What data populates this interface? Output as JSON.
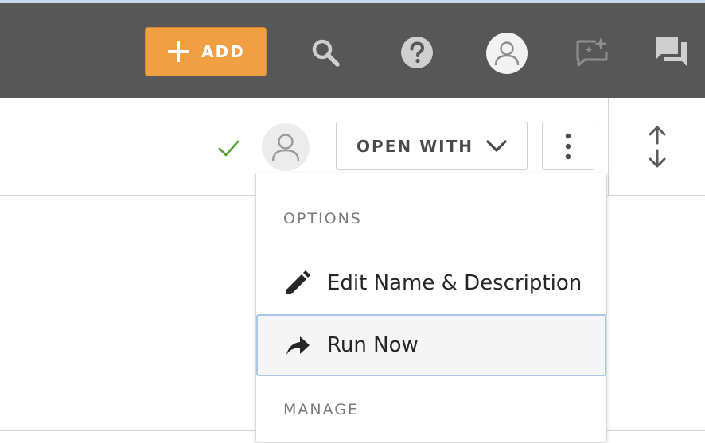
{
  "topbar": {
    "add_label": "ADD",
    "icons": [
      "plus-icon",
      "search-icon",
      "help-icon",
      "user-avatar-icon",
      "feedback-icon",
      "chat-icon"
    ],
    "colors": {
      "bar": "#575757",
      "add_button": "#f0a043"
    }
  },
  "toolbar": {
    "open_with_label": "OPEN WITH",
    "icons": [
      "check-icon",
      "owner-avatar-icon",
      "chevron-down-icon",
      "kebab-menu-icon",
      "sort-icon"
    ],
    "colors": {
      "check": "#5ba33a"
    }
  },
  "menu": {
    "sections": [
      {
        "header": "OPTIONS",
        "items": [
          {
            "label": "Edit Name & Description",
            "icon": "pencil-icon"
          },
          {
            "label": "Run Now",
            "icon": "share-arrow-icon",
            "highlighted": true
          }
        ]
      },
      {
        "header": "MANAGE"
      }
    ]
  }
}
